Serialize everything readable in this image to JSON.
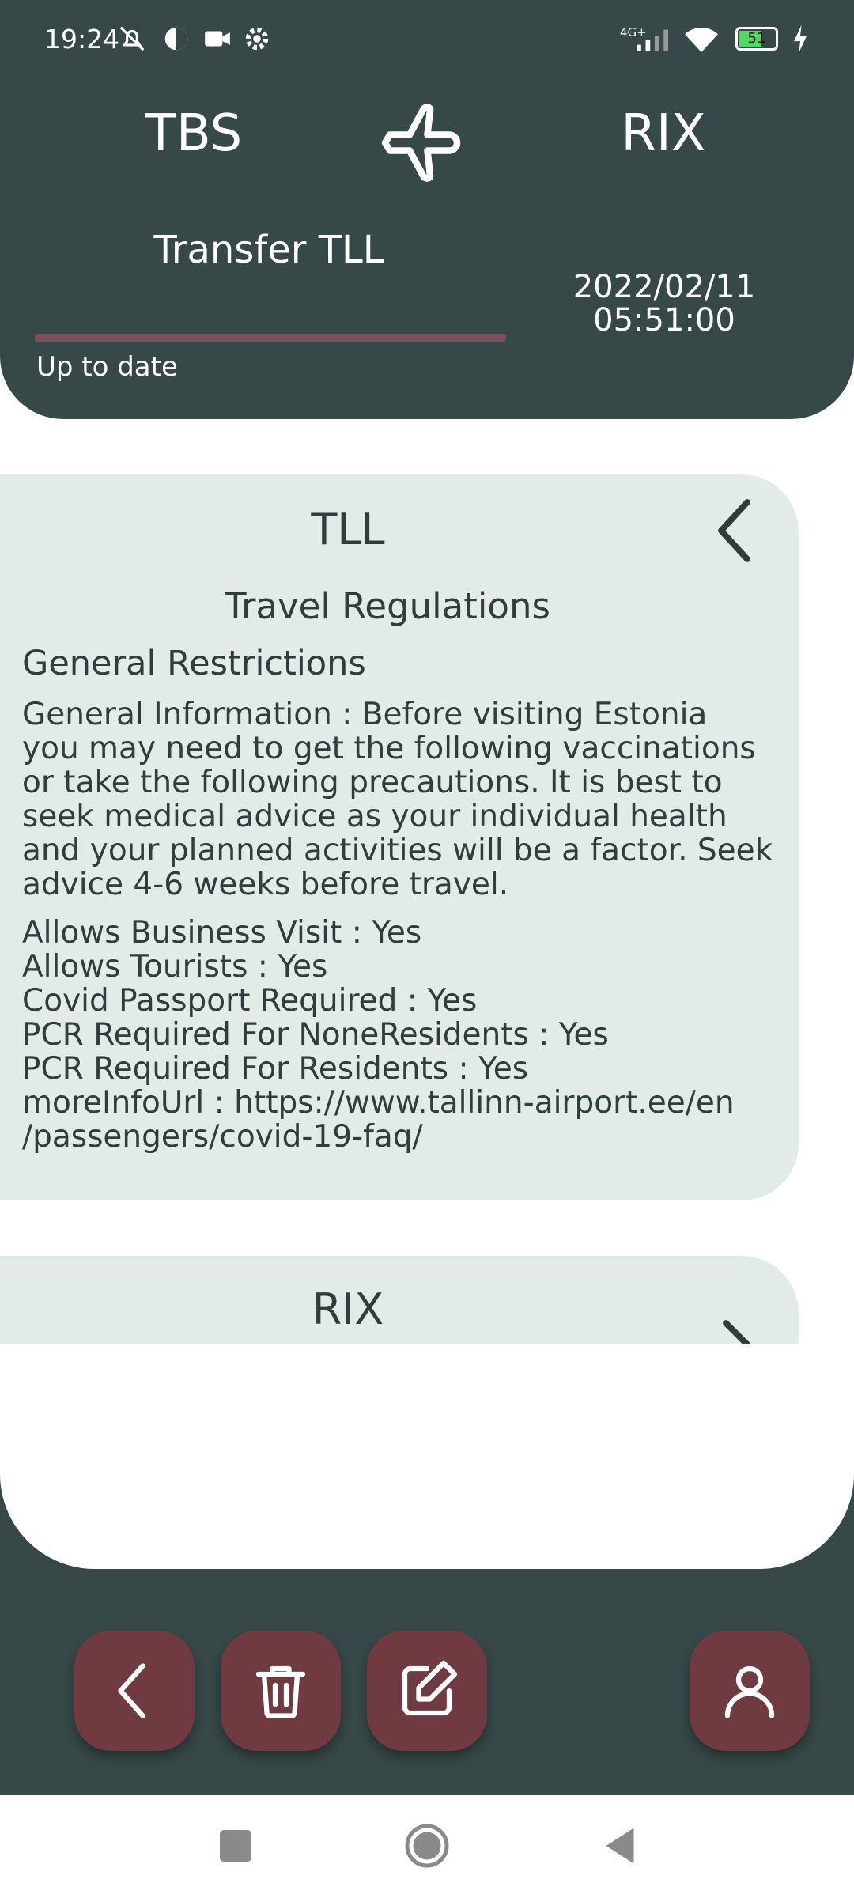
{
  "status_bar": {
    "time": "19:24",
    "icons": [
      "mute-icon",
      "data-saver-icon",
      "video-icon",
      "settings-icon",
      "signal-icon",
      "wifi-icon",
      "battery-icon",
      "charging-icon"
    ],
    "network": "4G+",
    "battery": "51"
  },
  "header": {
    "from": "TBS",
    "to": "RIX",
    "transfer": "Transfer TLL",
    "date": "2022/02/11",
    "time": "05:51:00",
    "status": "Up to date"
  },
  "cards": {
    "tll": {
      "title": "TLL",
      "section_heading": "Travel Regulations",
      "subheading": "General Restrictions",
      "general_information": "General Information : Before visiting Estonia you may need to get the following vaccinations or take the following precautions. It is best to seek medical advice as your individual health and your planned activities will be a factor. Seek advice 4-6 weeks before travel.",
      "facts": [
        "Allows Business Visit : Yes",
        "Allows Tourists : Yes",
        "Covid Passport Required : Yes",
        "PCR Required For NoneResidents : Yes",
        "PCR Required For Residents : Yes",
        "moreInfoUrl : https://www.tallinn-airport.ee/en",
        "/passengers/covid-19-faq/"
      ]
    },
    "rix": {
      "title": "RIX"
    }
  },
  "colors": {
    "header_bg": "#374848",
    "card_bg": "#e3ebe9",
    "accent": "#6f3a40",
    "progress": "#7a4f59"
  }
}
